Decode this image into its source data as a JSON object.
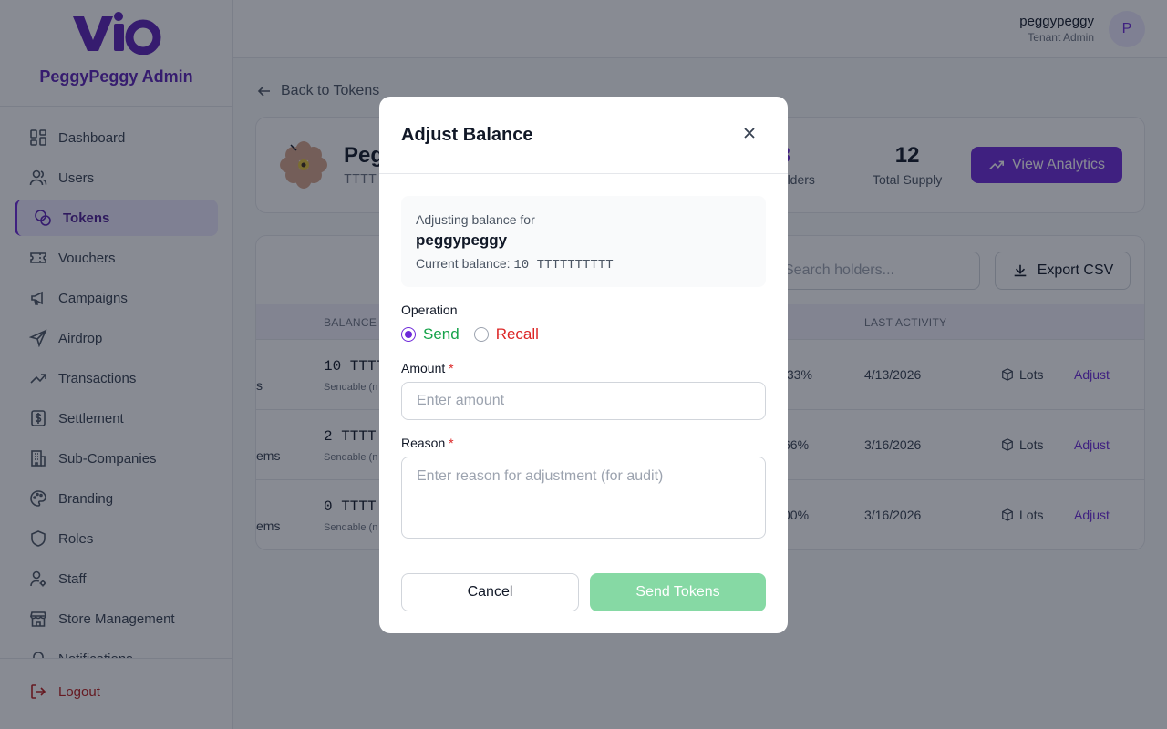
{
  "app": {
    "org_name": "PeggyPeggy Admin",
    "user_name": "peggypeggy",
    "user_role": "Tenant Admin",
    "avatar_initial": "P"
  },
  "sidebar": {
    "items": [
      {
        "label": "Dashboard",
        "icon": "dashboard-icon"
      },
      {
        "label": "Users",
        "icon": "users-icon"
      },
      {
        "label": "Tokens",
        "icon": "tokens-icon",
        "active": true
      },
      {
        "label": "Vouchers",
        "icon": "ticket-icon"
      },
      {
        "label": "Campaigns",
        "icon": "megaphone-icon"
      },
      {
        "label": "Airdrop",
        "icon": "send-icon"
      },
      {
        "label": "Transactions",
        "icon": "trending-up-icon"
      },
      {
        "label": "Settlement",
        "icon": "dollar-icon"
      },
      {
        "label": "Sub-Companies",
        "icon": "building-icon"
      },
      {
        "label": "Branding",
        "icon": "palette-icon"
      },
      {
        "label": "Roles",
        "icon": "shield-icon"
      },
      {
        "label": "Staff",
        "icon": "user-cog-icon"
      },
      {
        "label": "Store Management",
        "icon": "store-icon"
      },
      {
        "label": "Notifications",
        "icon": "bell-icon"
      }
    ],
    "logout_label": "Logout"
  },
  "main": {
    "back_label": "Back to Tokens",
    "token_name": "Peg",
    "token_symbol": "TTTT",
    "holders_count": "3",
    "holders_label": "tal Holders",
    "supply_count": "12",
    "supply_label": "Total Supply",
    "analytics_label": "View Analytics",
    "search_placeholder": "Search holders...",
    "export_label": "Export CSV",
    "columns": {
      "balance": "BALANCE",
      "last_activity": "LAST ACTIVITY"
    },
    "rows": [
      {
        "name_frag": "s",
        "balance": "10 TTTT",
        "sub": "Sendable (n",
        "share": ".33%",
        "last": "4/13/2026",
        "lots": "Lots",
        "adjust": "Adjust"
      },
      {
        "name_frag": "ems",
        "balance": "2 TTTT",
        "sub": "Sendable (n",
        "share": "66%",
        "last": "3/16/2026",
        "lots": "Lots",
        "adjust": "Adjust"
      },
      {
        "name_frag": "ems",
        "balance": "0 TTTT",
        "sub": "Sendable (n",
        "share": "00%",
        "last": "3/16/2026",
        "lots": "Lots",
        "adjust": "Adjust"
      }
    ]
  },
  "modal": {
    "title": "Adjust Balance",
    "adjusting_label": "Adjusting balance for",
    "username": "peggypeggy",
    "current_balance_label": "Current balance:",
    "current_balance_value": "10 TTTTTTTTTT",
    "operation_label": "Operation",
    "send_label": "Send",
    "recall_label": "Recall",
    "selected_operation": "Send",
    "amount_label": "Amount",
    "amount_placeholder": "Enter amount",
    "reason_label": "Reason",
    "reason_placeholder": "Enter reason for adjustment (for audit)",
    "required_mark": "*",
    "cancel_label": "Cancel",
    "submit_label": "Send Tokens"
  },
  "colors": {
    "brand": "#6d28d9",
    "send": "#16a34a",
    "recall": "#dc2626",
    "submit_disabled": "#86d9a4"
  }
}
